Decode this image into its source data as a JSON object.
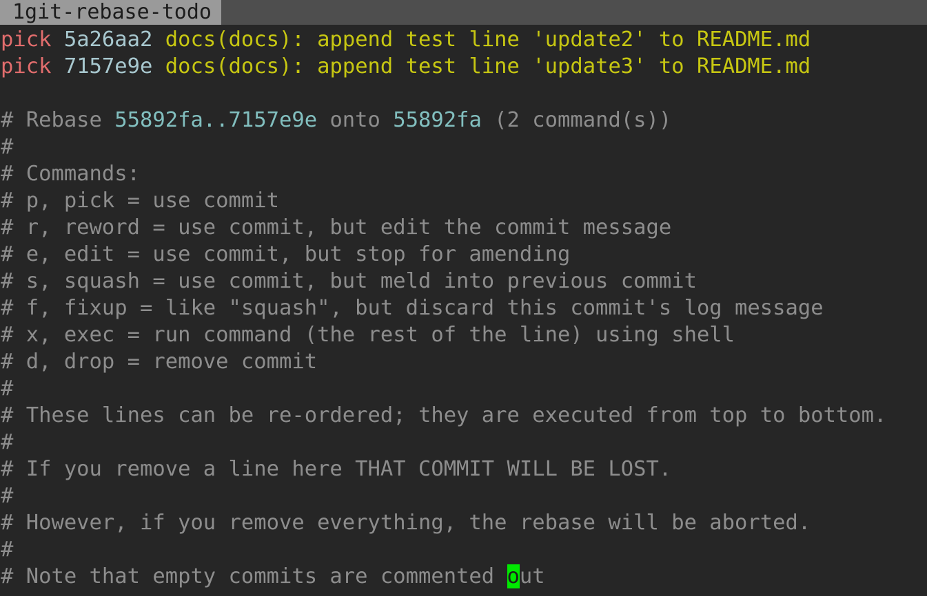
{
  "editor": {
    "name": "vim",
    "tab_label": "1git-rebase-todo",
    "colors": {
      "background": "#262626",
      "tabline_background": "#4e4e4e",
      "tab_active_background": "#9a9a9a",
      "tab_active_foreground": "#1c1c1c",
      "command_keyword": "#e26d6d",
      "commit_hash": "#a8c8cf",
      "commit_message": "#c7c712",
      "comment": "#8d8d8d",
      "comment_hash": "#82bfbf",
      "cursor_background": "#00e800",
      "cursor_foreground": "#1c1c1c"
    }
  },
  "todo_entries": [
    {
      "command": "pick",
      "hash": "5a26aa2",
      "message": "docs(docs): append test line 'update2' to README.md"
    },
    {
      "command": "pick",
      "hash": "7157e9e",
      "message": "docs(docs): append test line 'update3' to README.md"
    }
  ],
  "rebase_header": {
    "prefix": "# Rebase ",
    "range": "55892fa..7157e9e",
    "middle": " onto ",
    "onto": "55892fa",
    "suffix": " (2 command(s))"
  },
  "comment_lines": [
    "#",
    "# Commands:",
    "# p, pick = use commit",
    "# r, reword = use commit, but edit the commit message",
    "# e, edit = use commit, but stop for amending",
    "# s, squash = use commit, but meld into previous commit",
    "# f, fixup = like \"squash\", but discard this commit's log message",
    "# x, exec = run command (the rest of the line) using shell",
    "# d, drop = remove commit",
    "#",
    "# These lines can be re-ordered; they are executed from top to bottom.",
    "#",
    "# If you remove a line here THAT COMMIT WILL BE LOST.",
    "#",
    "# However, if you remove everything, the rebase will be aborted.",
    "#"
  ],
  "last_line": {
    "before_cursor": "# Note that empty commits are commented ",
    "cursor_char": "o",
    "after_cursor": "ut"
  },
  "blank_line": ""
}
